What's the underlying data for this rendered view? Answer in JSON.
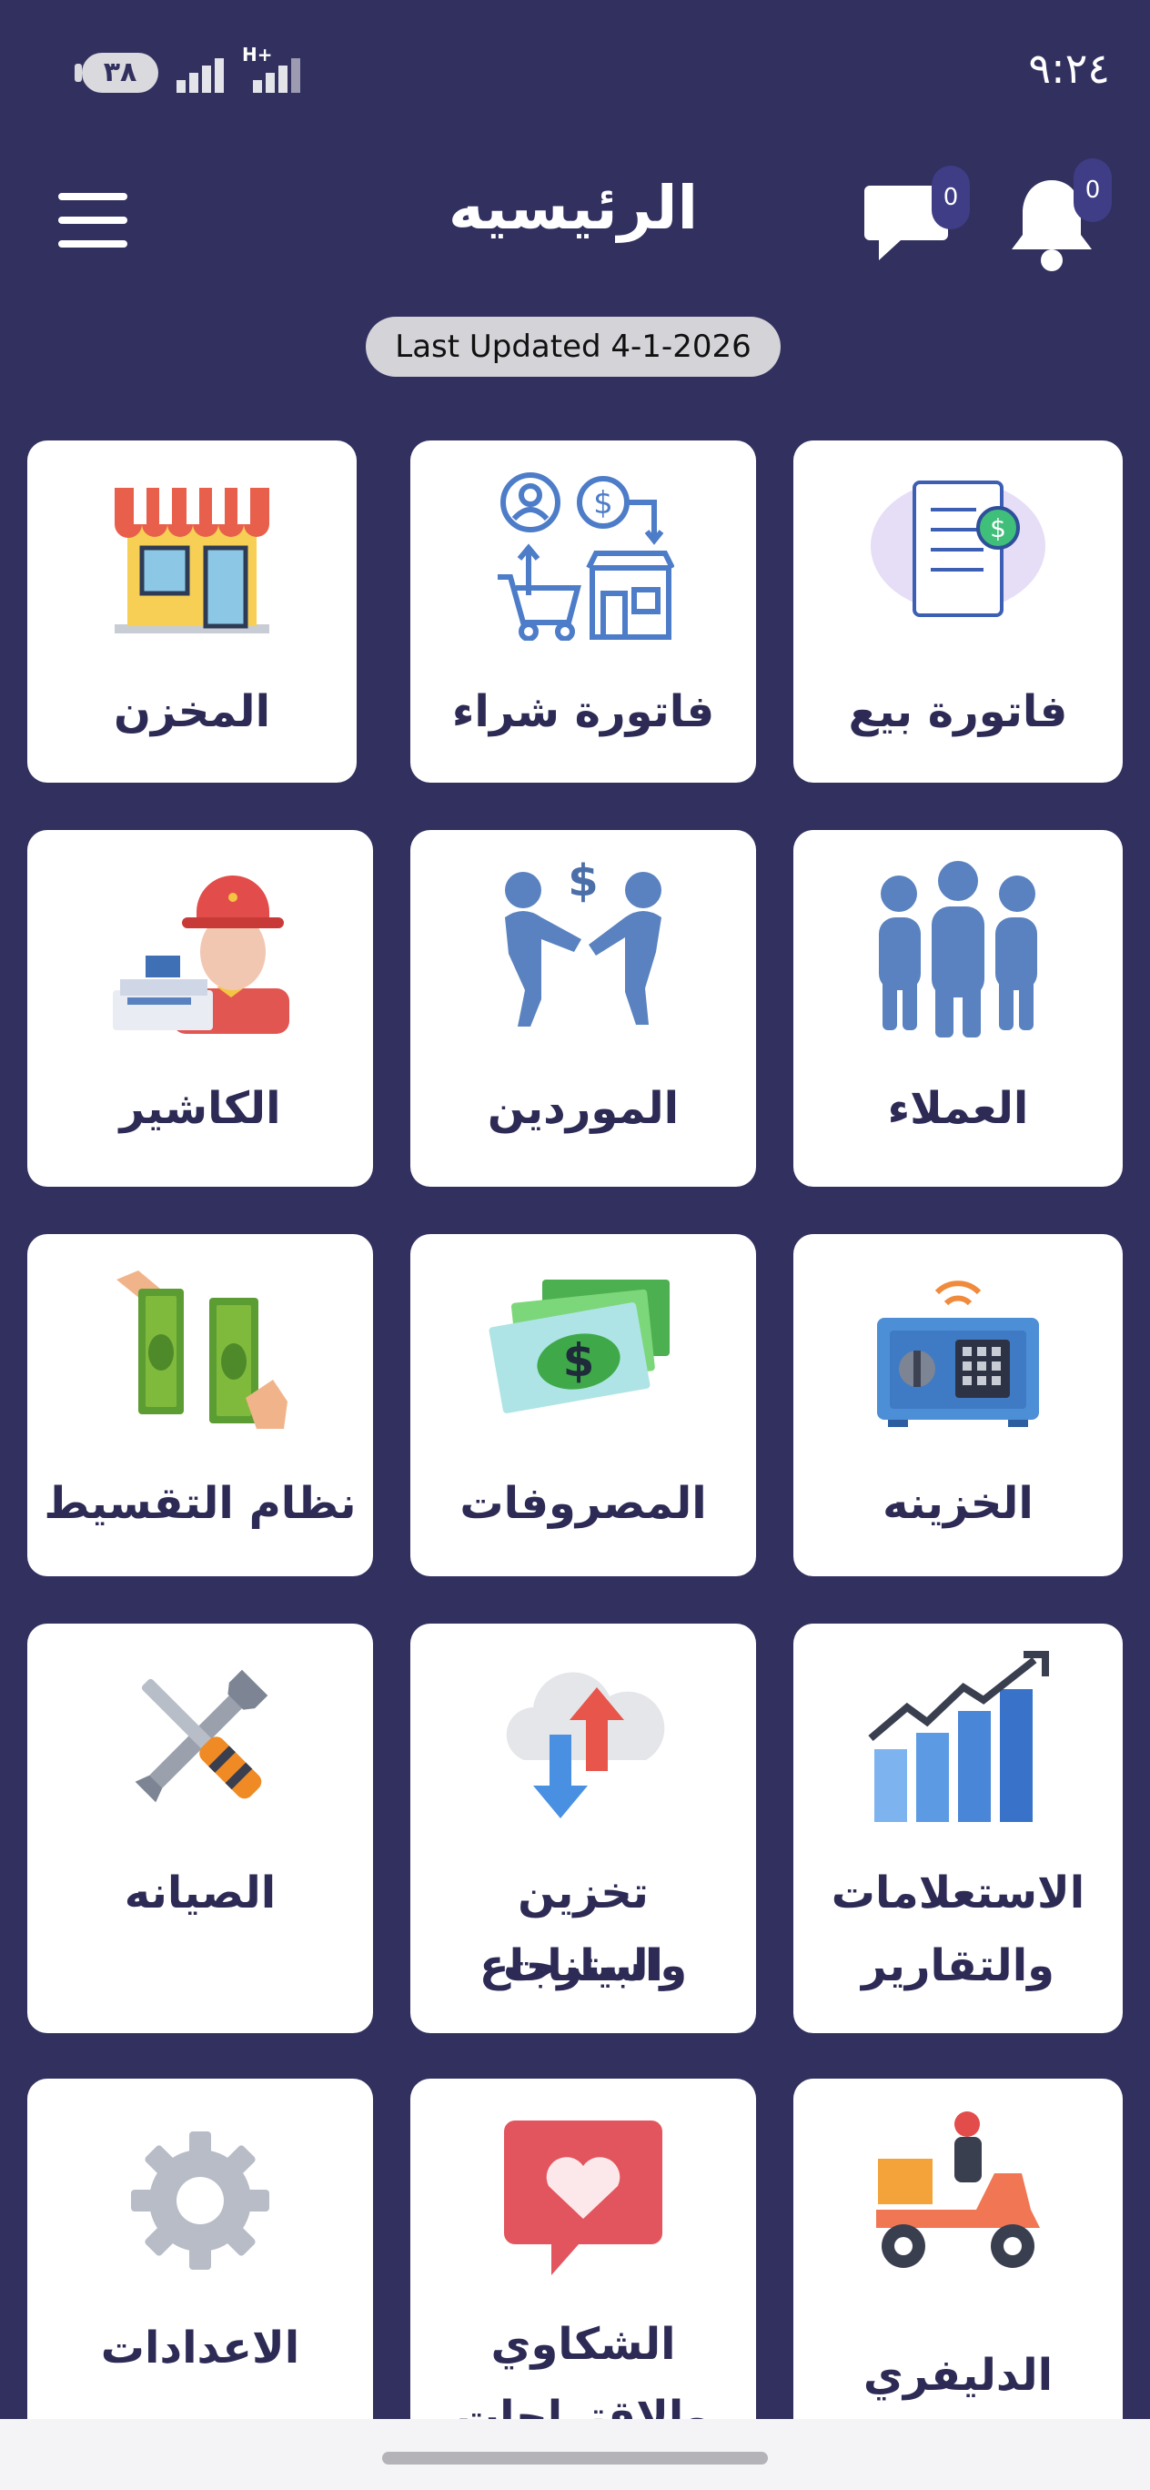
{
  "status_bar": {
    "time": "٩:٢٤",
    "battery": "٣٨",
    "network": "H+"
  },
  "header": {
    "title": "الرئيسيه",
    "chat_count": "0",
    "notification_count": "0",
    "icons": [
      "menu-icon",
      "chat-icon",
      "bell-icon"
    ]
  },
  "last_updated": "Last Updated 4-1-2026",
  "tiles": [
    {
      "label": "فاتورة بيع",
      "icon": "sales-invoice-icon"
    },
    {
      "label": "فاتورة شراء",
      "icon": "purchase-invoice-icon"
    },
    {
      "label": "المخزن",
      "icon": "store-icon"
    },
    {
      "label": "العملاء",
      "icon": "customers-icon"
    },
    {
      "label": "الموردين",
      "icon": "suppliers-icon"
    },
    {
      "label": "الكاشير",
      "icon": "cashier-icon"
    },
    {
      "label": "الخزينه",
      "icon": "safe-icon"
    },
    {
      "label": "المصروفات",
      "icon": "money-icon"
    },
    {
      "label": "نظام التقسيط",
      "icon": "installment-icon"
    },
    {
      "label": "الاستعلامات والتقارير",
      "line1": "الاستعلامات",
      "line2": "والتقارير",
      "icon": "reports-chart-icon"
    },
    {
      "label": "تخزين واسترجاع البيانات",
      "line1": "تخزين واسترجاع",
      "line2": "البيانات",
      "icon": "cloud-backup-icon"
    },
    {
      "label": "الصيانه",
      "icon": "tools-icon"
    },
    {
      "label": "الدليفري",
      "icon": "delivery-scooter-icon"
    },
    {
      "label": "الشكاوي والاقتراحات",
      "line1": "الشكاوي",
      "line2": "والاقتراحات",
      "icon": "complaints-heart-icon"
    },
    {
      "label": "الاعدادات",
      "icon": "settings-gear-icon"
    }
  ],
  "colors": {
    "background": "#32305f",
    "tile": "#ffffff",
    "label": "#2d2b55",
    "accent_blue": "#4d7cc8"
  }
}
